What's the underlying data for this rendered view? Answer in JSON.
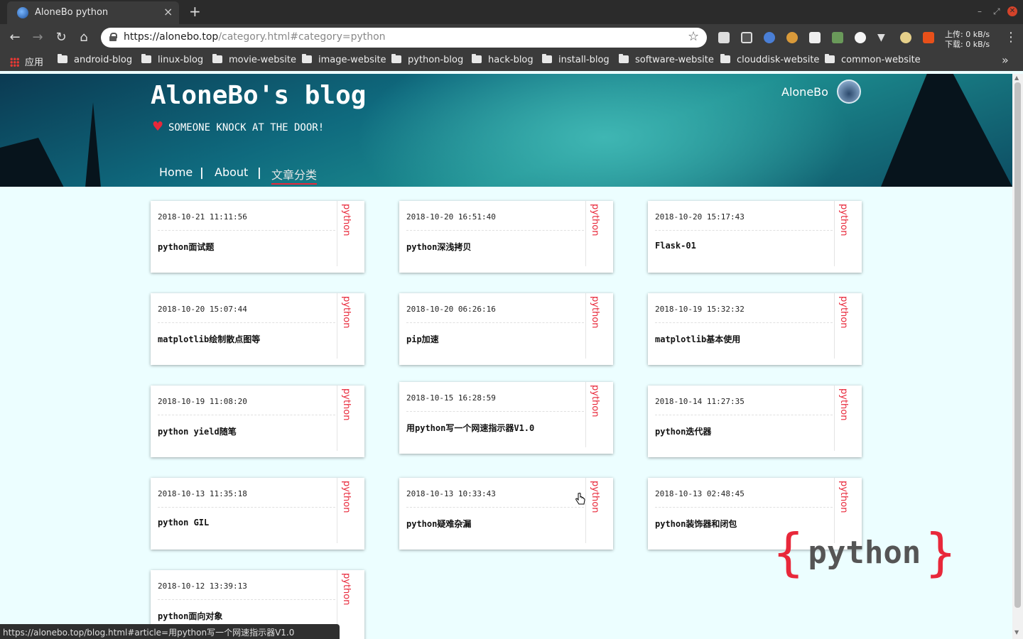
{
  "browser": {
    "tab_title": "AloneBo python",
    "tab_close": "×",
    "new_tab": "+",
    "url_host": "https://alonebo.top",
    "url_path": "/category.html#category=python",
    "net_up": "上传: 0 kB/s",
    "net_down": "下载: 0 kB/s",
    "bookmarks": [
      "应用",
      "android-blog",
      "linux-blog",
      "movie-website",
      "image-website",
      "python-blog",
      "hack-blog",
      "install-blog",
      "software-website",
      "clouddisk-website",
      "common-website"
    ],
    "status_url": "https://alonebo.top/blog.html#article=用python写一个网速指示器V1.0"
  },
  "site": {
    "title": "AloneBo's blog",
    "slogan": "SOMEONE KNOCK AT THE DOOR!",
    "author": "AloneBo",
    "nav": [
      "Home",
      "About",
      "文章分类"
    ],
    "nav_sep": "|",
    "brand_word": "python",
    "brace_open": "{",
    "brace_close": "}"
  },
  "articles": [
    {
      "date": "2018-10-21 11:11:56",
      "title": "python面试题",
      "tag": "python"
    },
    {
      "date": "2018-10-20 16:51:40",
      "title": "python深浅拷贝",
      "tag": "python"
    },
    {
      "date": "2018-10-20 15:17:43",
      "title": "Flask-01",
      "tag": "python"
    },
    {
      "date": "2018-10-20 15:07:44",
      "title": "matplotlib绘制散点图等",
      "tag": "python"
    },
    {
      "date": "2018-10-20 06:26:16",
      "title": "pip加速",
      "tag": "python"
    },
    {
      "date": "2018-10-19 15:32:32",
      "title": "matplotlib基本使用",
      "tag": "python"
    },
    {
      "date": "2018-10-19 11:08:20",
      "title": "python yield随笔",
      "tag": "python"
    },
    {
      "date": "2018-10-15 16:28:59",
      "title": "用python写一个网速指示器V1.0",
      "tag": "python"
    },
    {
      "date": "2018-10-14 11:27:35",
      "title": "python迭代器",
      "tag": "python"
    },
    {
      "date": "2018-10-13 11:35:18",
      "title": "python GIL",
      "tag": "python"
    },
    {
      "date": "2018-10-13 10:33:43",
      "title": "python疑难杂漏",
      "tag": "python"
    },
    {
      "date": "2018-10-13 02:48:45",
      "title": "python装饰器和闭包",
      "tag": "python"
    },
    {
      "date": "2018-10-12 13:39:13",
      "title": "python面向对象",
      "tag": "python"
    }
  ],
  "colors": {
    "accent": "#e8283a",
    "page_bg": "#ecfeff",
    "header_bg": "#0f6a7e"
  }
}
